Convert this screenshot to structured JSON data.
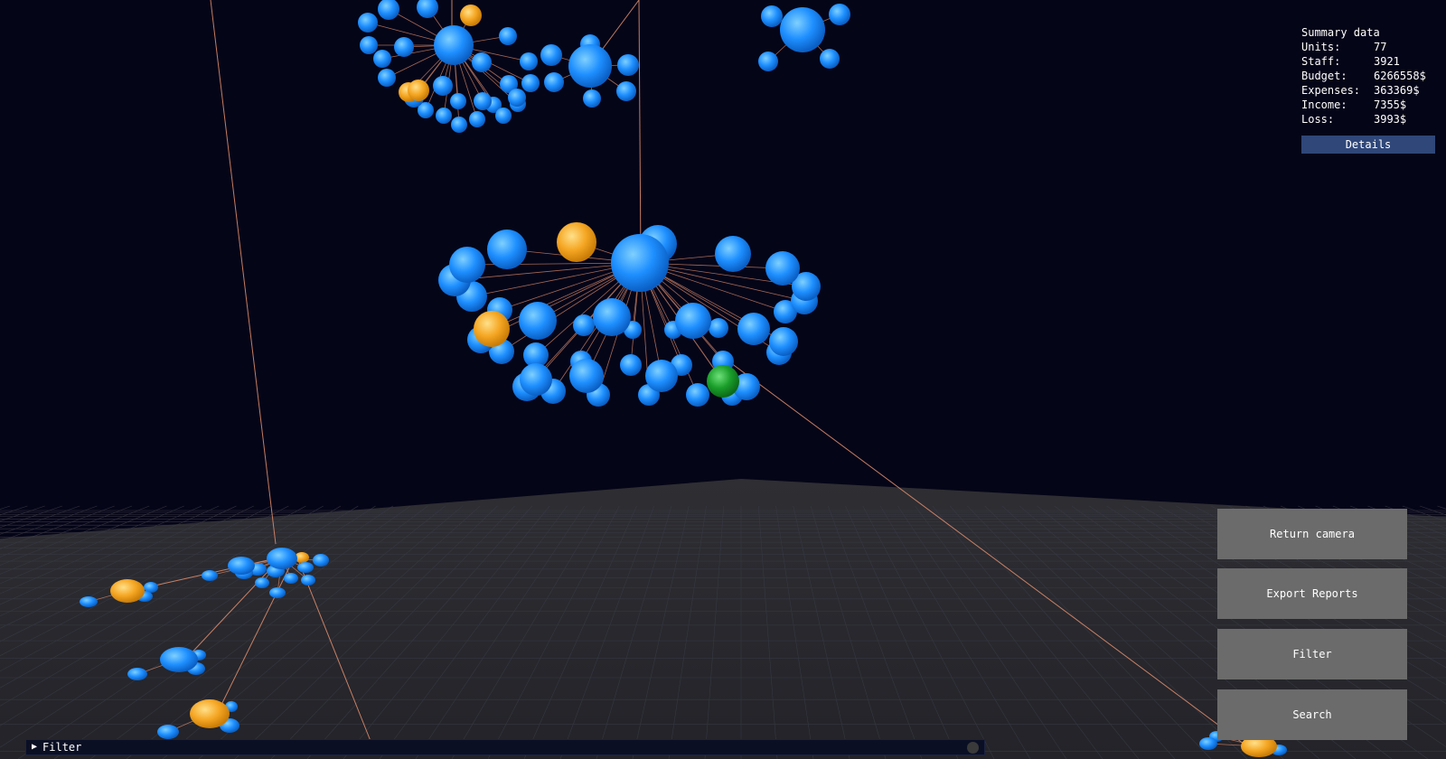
{
  "summary": {
    "title": "Summary data",
    "rows": [
      {
        "label": "Units:",
        "value": "77"
      },
      {
        "label": "Staff:",
        "value": "3921"
      },
      {
        "label": "Budget:",
        "value": "6266558$"
      },
      {
        "label": "Expenses:",
        "value": "363369$"
      },
      {
        "label": "Income:",
        "value": "7355$"
      },
      {
        "label": "Loss:",
        "value": "3993$"
      }
    ],
    "details_label": "Details"
  },
  "actions": {
    "return_camera": "Return camera",
    "export_reports": "Export Reports",
    "filter": "Filter",
    "search": "Search"
  },
  "filter_bar": {
    "label": "Filter"
  },
  "colors": {
    "background": "#050518",
    "node_blue": "#1e90ff",
    "node_orange": "#f5a623",
    "node_green": "#1a9e2a",
    "edge": "#d98a6a",
    "grid": "#2a2a33",
    "button": "#6b6b6b",
    "details_button": "#2f4779"
  }
}
